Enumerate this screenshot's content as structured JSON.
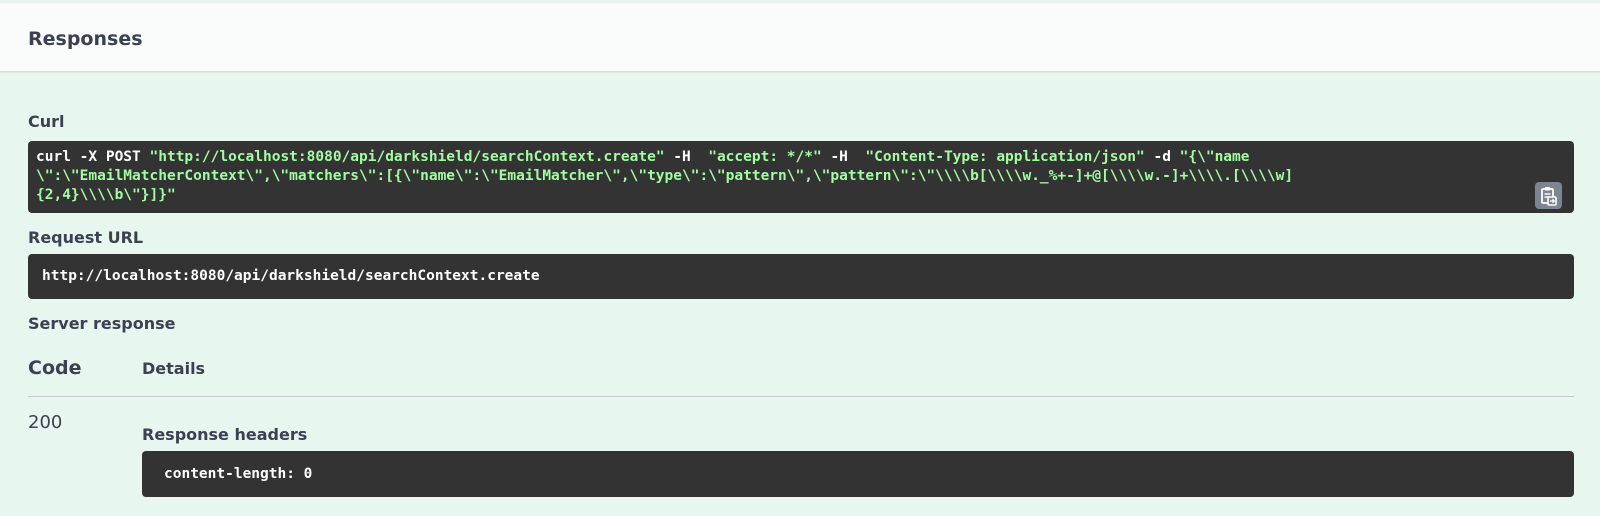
{
  "responses": {
    "title": "Responses"
  },
  "curl": {
    "label": "Curl",
    "line1_cmd": "curl -X POST ",
    "line1_url": "\"http://localhost:8080/api/darkshield/searchContext.create\"",
    "line1_h1": " -H  ",
    "line1_accept": "\"accept: */*\"",
    "line1_h2": " -H  ",
    "line1_ctype": "\"Content-Type: application/json\"",
    "line1_d": " -d ",
    "line1_body": "\"{\\\"name",
    "line2_body": "\\\":\\\"EmailMatcherContext\\\",\\\"matchers\\\":[{\\\"name\\\":\\\"EmailMatcher\\\",\\\"type\\\":\\\"pattern\\\",\\\"pattern\\\":\\\"\\\\\\\\b[\\\\\\\\w._%+-]+@[\\\\\\\\w.-]+\\\\\\\\.[\\\\\\\\w]",
    "line3_body": "{2,4}\\\\\\\\b\\\"}]}\"",
    "copy_icon": "clipboard-copy-icon"
  },
  "request_url": {
    "label": "Request URL",
    "value": "http://localhost:8080/api/darkshield/searchContext.create"
  },
  "server_response": {
    "label": "Server response",
    "col_code": "Code",
    "col_details": "Details",
    "rows": [
      {
        "code": "200",
        "headers_label": "Response headers",
        "headers_value": "content-length: 0"
      }
    ]
  },
  "colors": {
    "background": "#e8f6f0",
    "header_bg": "#fafcfb",
    "code_bg": "#333333",
    "string_green": "#a2fca2",
    "text": "#3b4151"
  }
}
